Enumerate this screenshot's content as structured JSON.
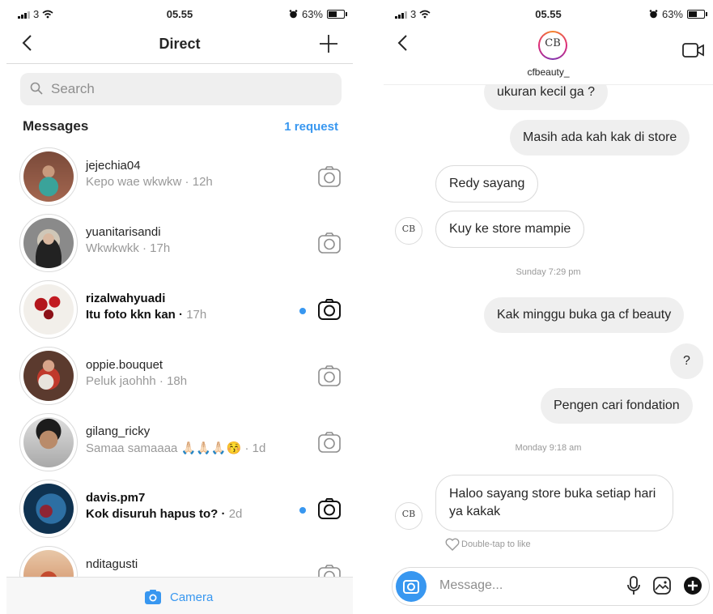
{
  "left": {
    "status": {
      "carrier": "3",
      "time": "05.55",
      "battery": "63%",
      "battery_level": 0.63
    },
    "header": {
      "title": "Direct"
    },
    "search": {
      "placeholder": "Search"
    },
    "section": {
      "title": "Messages",
      "requests": "1 request"
    },
    "threads": [
      {
        "username": "jejechia04",
        "preview": "Kepo wae wkwkw",
        "ago": "12h",
        "unread": false
      },
      {
        "username": "yuanitarisandi",
        "preview": "Wkwkwkk",
        "ago": "17h",
        "unread": false
      },
      {
        "username": "rizalwahyuadi",
        "preview": "Itu foto kkn kan",
        "ago": "17h",
        "unread": true
      },
      {
        "username": "oppie.bouquet",
        "preview": "Peluk jaohhh",
        "ago": "18h",
        "unread": false
      },
      {
        "username": "gilang_ricky",
        "preview": "Samaa samaaaa 🙏🏻🙏🏻🙏🏻😚",
        "ago": "1d",
        "unread": false
      },
      {
        "username": "davis.pm7",
        "preview": "Kok disuruh hapus to?",
        "ago": "2d",
        "unread": true
      },
      {
        "username": "nditagusti",
        "preview": "",
        "ago": "",
        "unread": false
      }
    ],
    "bottom": {
      "camera_label": "Camera"
    },
    "colors": {
      "accent": "#3897f0"
    }
  },
  "right": {
    "status": {
      "carrier": "3",
      "time": "05.55",
      "battery": "63%",
      "battery_level": 0.63
    },
    "header": {
      "username": "cfbeauty_",
      "monogram": "CB"
    },
    "messages": [
      {
        "text": "ukuran kecil ga ?",
        "from": "me"
      },
      {
        "text": "Masih ada kah kak di store",
        "from": "me"
      },
      {
        "text": "Redy sayang",
        "from": "them"
      },
      {
        "text": "Kuy ke store mampie",
        "from": "them"
      },
      {
        "text": "Kak minggu buka ga cf beauty",
        "from": "me"
      },
      {
        "text": "?",
        "from": "me"
      },
      {
        "text": "Pengen cari fondation",
        "from": "me"
      },
      {
        "text": "Haloo sayang store buka setiap hari ya kakak",
        "from": "them"
      }
    ],
    "timestamps": [
      "Sunday 7:29 pm",
      "Monday 9:18 am"
    ],
    "double_tap": "Double-tap to like",
    "composer": {
      "placeholder": "Message..."
    }
  }
}
